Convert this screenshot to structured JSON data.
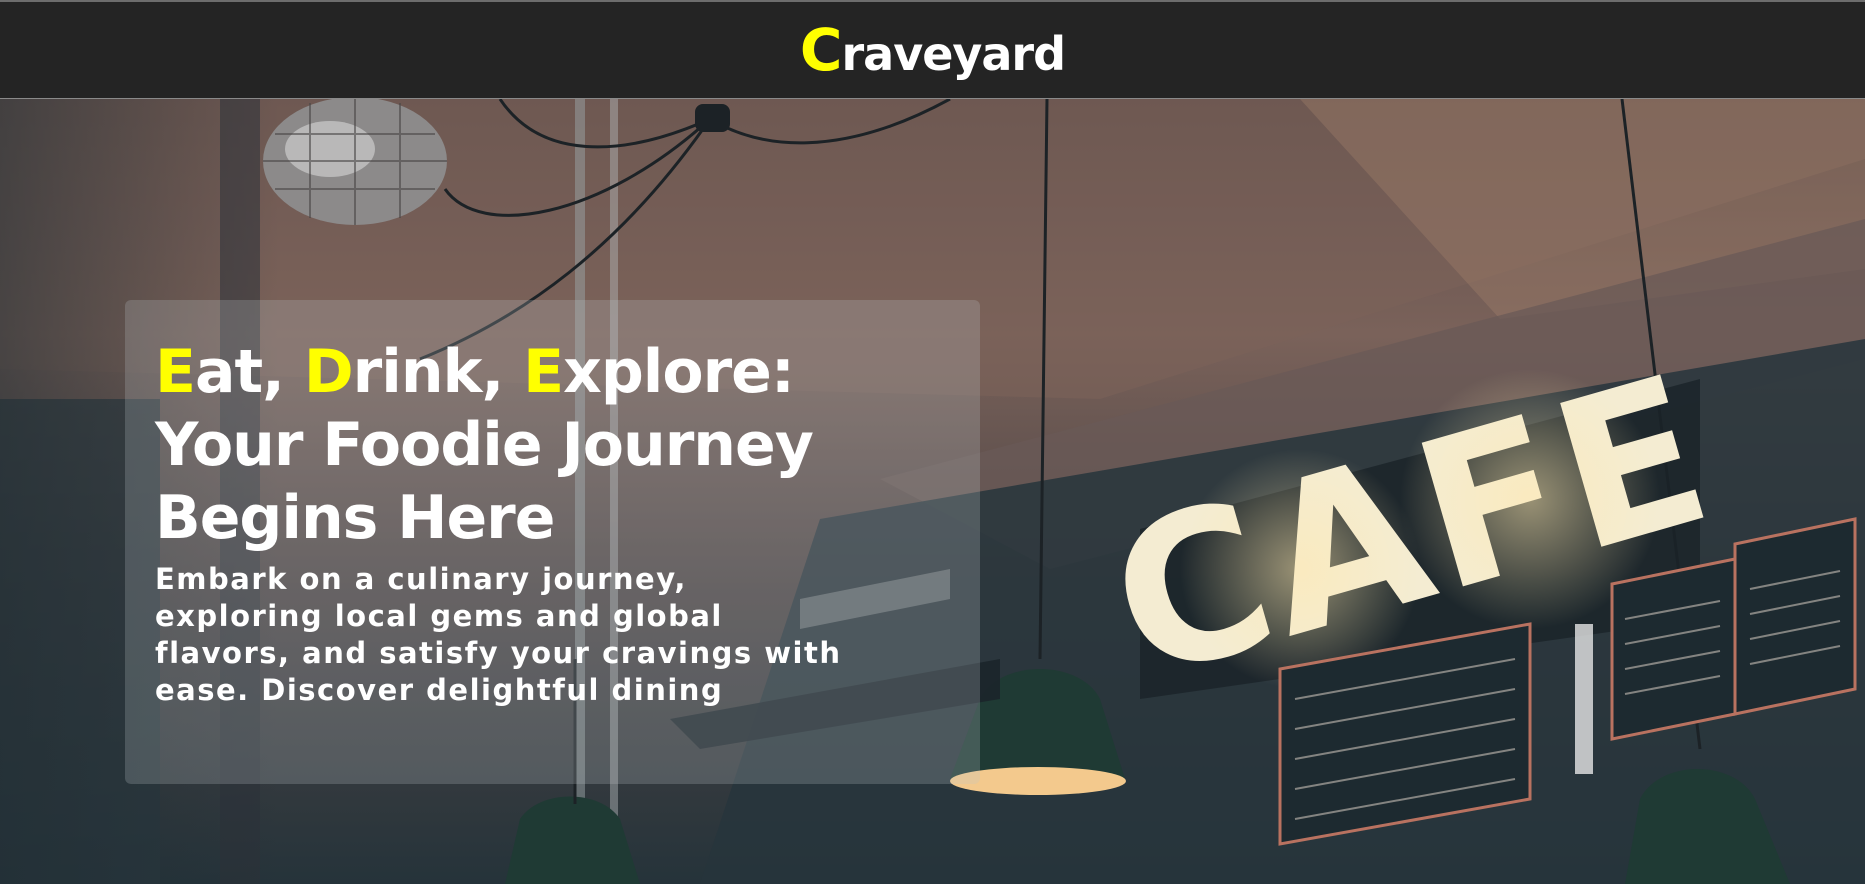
{
  "header": {
    "logo_first_letter": "C",
    "logo_rest": "raveyard"
  },
  "hero": {
    "headline": {
      "line1": [
        {
          "cap": "E",
          "rest": "at, "
        },
        {
          "cap": "D",
          "rest": "rink, "
        },
        {
          "cap": "E",
          "rest": "xplore:"
        }
      ],
      "line2": "Your Foodie Journey",
      "line3": "Begins Here"
    },
    "subtext": "Embark on a culinary journey, exploring local gems and global flavors, and satisfy your cravings with ease. Discover delightful dining",
    "background_sign": "CAFE",
    "background_icons": [
      "disco-ball-icon",
      "pendant-lamp-icon",
      "cafe-sign-icon",
      "menu-board-icon"
    ]
  },
  "colors": {
    "accent": "#ffff00",
    "header_bg": "#242424",
    "text": "#ffffff"
  }
}
